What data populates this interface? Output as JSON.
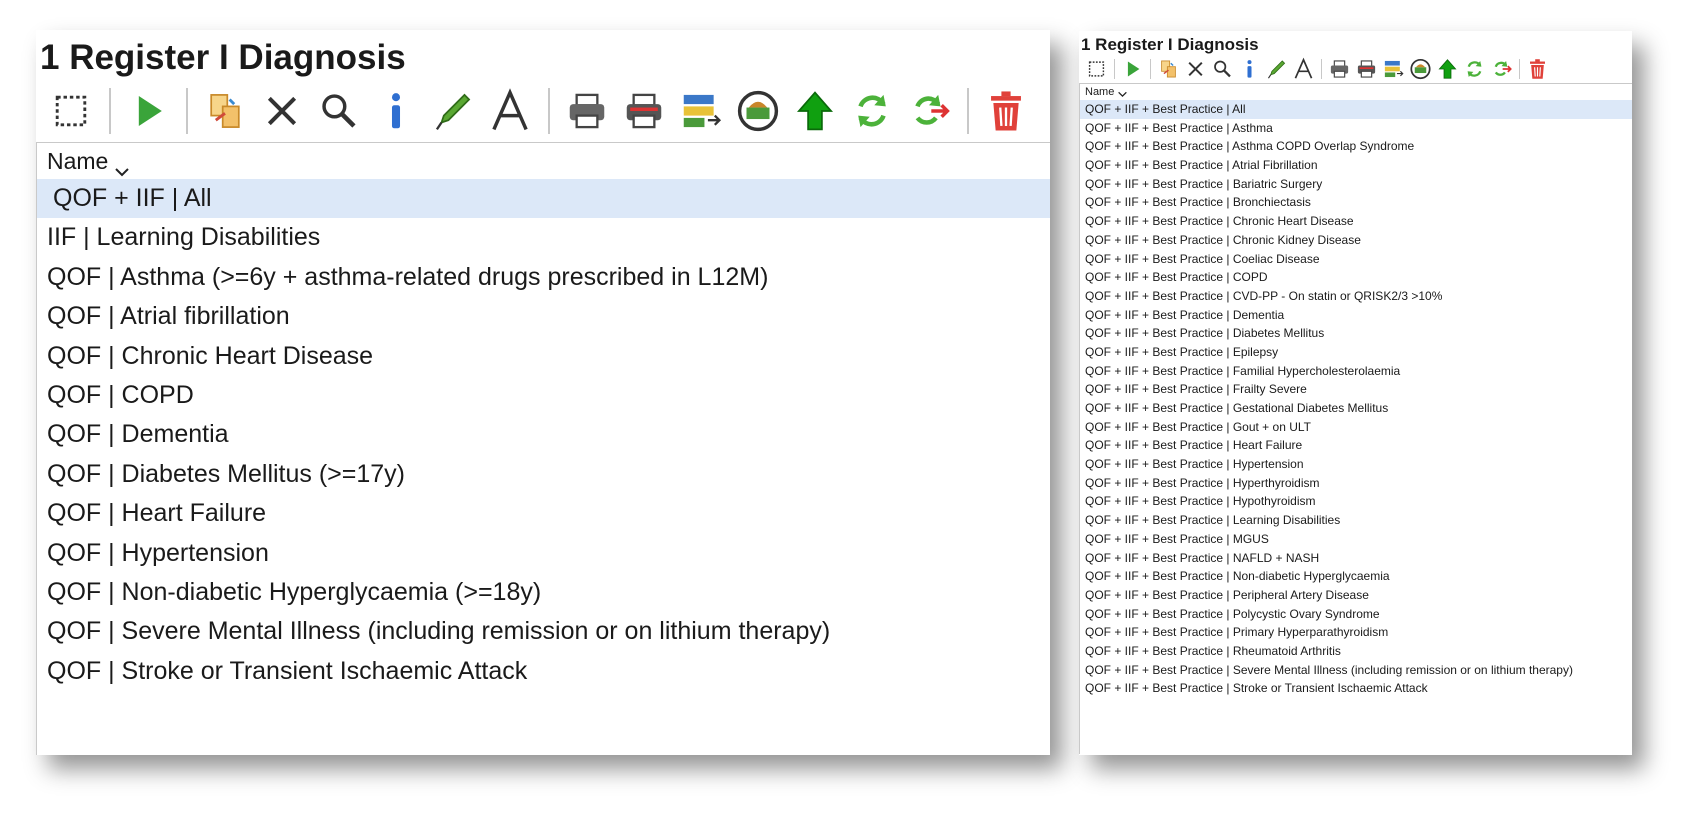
{
  "left_panel": {
    "title": "1 Register I Diagnosis",
    "column_header": "Name",
    "rows": [
      "QOF + IIF | All",
      "IIF | Learning Disabilities",
      "QOF | Asthma (>=6y + asthma-related drugs prescribed in L12M)",
      "QOF | Atrial fibrillation",
      "QOF | Chronic Heart Disease",
      "QOF | COPD",
      "QOF | Dementia",
      "QOF | Diabetes Mellitus (>=17y)",
      "QOF | Heart Failure",
      "QOF | Hypertension",
      "QOF | Non-diabetic Hyperglycaemia (>=18y)",
      "QOF | Severe Mental Illness (including remission or on lithium therapy)",
      "QOF | Stroke or Transient Ischaemic Attack"
    ],
    "selected_index": 0
  },
  "right_panel": {
    "title": "1 Register I Diagnosis",
    "column_header": "Name",
    "rows": [
      "QOF + IIF + Best Practice | All",
      "QOF + IIF + Best Practice | Asthma",
      "QOF + IIF + Best Practice | Asthma COPD Overlap Syndrome",
      "QOF + IIF + Best Practice | Atrial Fibrillation",
      "QOF + IIF + Best Practice | Bariatric Surgery",
      "QOF + IIF + Best Practice | Bronchiectasis",
      "QOF + IIF + Best Practice | Chronic Heart Disease",
      "QOF + IIF + Best Practice | Chronic Kidney Disease",
      "QOF + IIF + Best Practice | Coeliac Disease",
      "QOF + IIF + Best Practice | COPD",
      "QOF + IIF + Best Practice | CVD-PP - On statin or QRISK2/3 >10%",
      "QOF + IIF + Best Practice | Dementia",
      "QOF + IIF + Best Practice | Diabetes Mellitus",
      "QOF + IIF + Best Practice | Epilepsy",
      "QOF + IIF + Best Practice | Familial Hypercholesterolaemia",
      "QOF + IIF + Best Practice | Frailty Severe",
      "QOF + IIF + Best Practice | Gestational Diabetes Mellitus",
      "QOF + IIF + Best Practice | Gout + on ULT",
      "QOF + IIF + Best Practice | Heart Failure",
      "QOF + IIF + Best Practice | Hypertension",
      "QOF + IIF + Best Practice | Hyperthyroidism",
      "QOF + IIF + Best Practice | Hypothyroidism",
      "QOF + IIF + Best Practice | Learning Disabilities",
      "QOF + IIF + Best Practice | MGUS",
      "QOF + IIF + Best Practice | NAFLD + NASH",
      "QOF + IIF + Best Practice | Non-diabetic Hyperglycaemia",
      "QOF + IIF + Best Practice | Peripheral Artery Disease",
      "QOF + IIF + Best Practice | Polycystic Ovary Syndrome",
      "QOF + IIF + Best Practice | Primary Hyperparathyroidism",
      "QOF + IIF + Best Practice | Rheumatoid Arthritis",
      "QOF + IIF + Best Practice | Severe Mental Illness (including remission or on lithium therapy)",
      "QOF + IIF + Best Practice | Stroke or Transient Ischaemic Attack"
    ],
    "selected_index": 0
  },
  "toolbar_icons": [
    "select-all-icon",
    "separator",
    "run-icon",
    "separator",
    "copy-icon",
    "delete-icon",
    "search-icon",
    "info-icon",
    "edit-icon",
    "rename-icon",
    "separator",
    "print-icon",
    "print-report-icon",
    "export-icon",
    "batch-icon",
    "move-up-icon",
    "refresh-icon",
    "refresh-forward-icon",
    "separator",
    "trash-icon"
  ],
  "colors": {
    "selected_row": "#dce8f8",
    "run_green": "#3aa43a",
    "info_blue": "#2f6fd1",
    "trash_red": "#e0413a",
    "up_green": "#10a010"
  }
}
